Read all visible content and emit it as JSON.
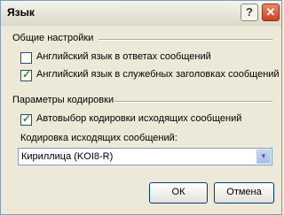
{
  "window": {
    "title": "Язык",
    "help_icon": "?",
    "close_icon": "✕"
  },
  "general_group": {
    "label": "Общие настройки",
    "options": [
      {
        "label": "Английский язык в ответах сообщений",
        "checked": false
      },
      {
        "label": "Английский язык в служебных заголовках сообщений",
        "checked": true
      }
    ]
  },
  "encoding_group": {
    "label": "Параметры кодировки",
    "auto_select": {
      "label": "Автовыбор кодировки исходящих сообщений",
      "checked": true
    },
    "outgoing_label": "Кодировка исходящих сообщений:",
    "outgoing_value": "Кириллица (KOI8-R)",
    "dropdown_icon": "▼"
  },
  "buttons": {
    "ok": "ОК",
    "cancel": "Отмена"
  }
}
